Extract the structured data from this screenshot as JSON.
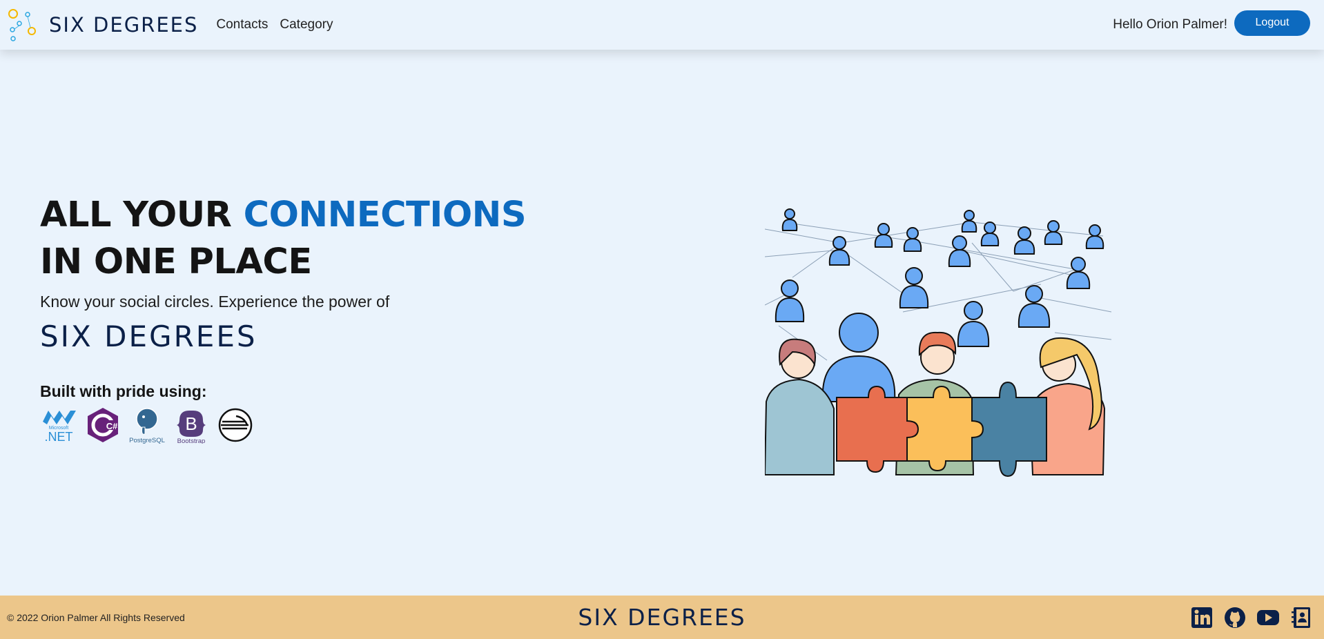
{
  "navbar": {
    "brand": "SIX DEGREES",
    "links": [
      "Contacts",
      "Category"
    ],
    "greeting": "Hello Orion Palmer!",
    "logout_label": "Logout"
  },
  "hero": {
    "title_part1": "ALL YOUR ",
    "title_accent": "CONNECTIONS",
    "title_part2": " IN ONE PLACE",
    "subtitle": "Know your social circles. Experience the power of",
    "brand": "SIX DEGREES",
    "built_with": "Built with pride using:",
    "tech_icons": [
      "dotnet-icon",
      "csharp-icon",
      "postgresql-icon",
      "bootstrap-icon",
      "railway-icon"
    ],
    "tech_labels": {
      "dotnet_small": "Microsoft",
      "dotnet": ".NET",
      "csharp": "C#",
      "postgresql": "PostgreSQL",
      "bootstrap": "Bootstrap",
      "bootstrap_letter": "B"
    }
  },
  "footer": {
    "copyright": "© 2022 Orion Palmer All Rights Reserved",
    "brand": "SIX DEGREES",
    "social_icons": [
      "linkedin-icon",
      "github-icon",
      "youtube-icon",
      "contact-book-icon"
    ]
  },
  "colors": {
    "accent": "#0d6abf",
    "brand_navy": "#0b2048",
    "footer_bg": "#ecc68a",
    "page_bg": "#eaf3fc"
  }
}
